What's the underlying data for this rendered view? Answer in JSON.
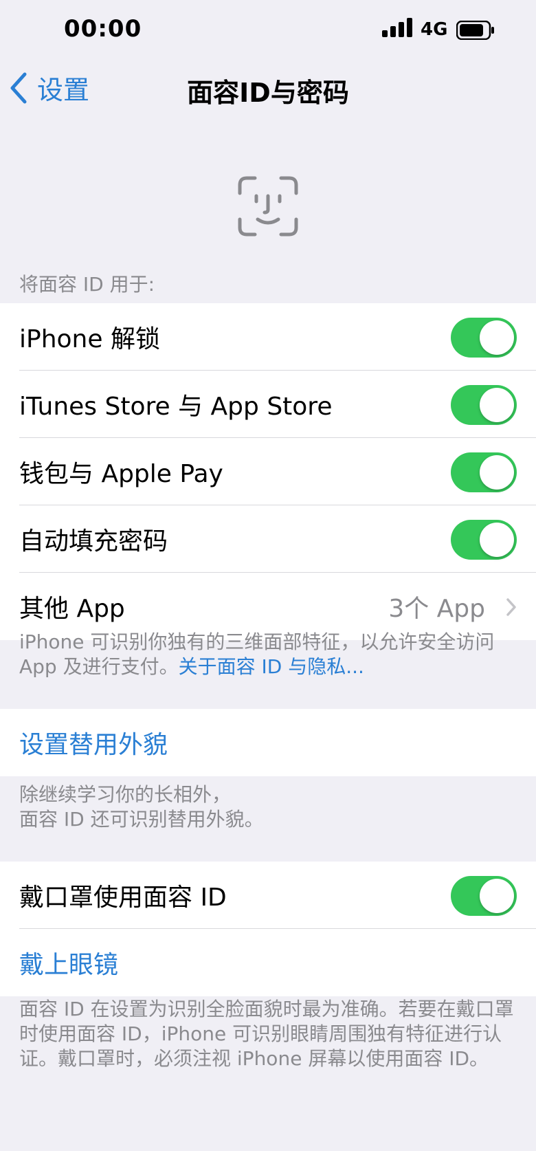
{
  "status_bar": {
    "time": "00:00",
    "network": "4G"
  },
  "nav": {
    "back_label": "设置",
    "title": "面容ID与密码"
  },
  "use_for": {
    "header": "将面容 ID 用于:",
    "items": [
      {
        "label": "iPhone 解锁",
        "on": true
      },
      {
        "label": "iTunes Store 与 App Store",
        "on": true
      },
      {
        "label": "钱包与 Apple Pay",
        "on": true
      },
      {
        "label": "自动填充密码",
        "on": true
      }
    ],
    "other_apps": {
      "label": "其他 App",
      "detail": "3个 App"
    },
    "footer_text": "iPhone 可识别你独有的三维面部特征，以允许安全访问 App 及进行支付。",
    "footer_link": "关于面容 ID 与隐私..."
  },
  "alternate": {
    "button": "设置替用外貌",
    "footer_line1": "除继续学习你的长相外，",
    "footer_line2": "面容 ID 还可识别替用外貌。"
  },
  "mask": {
    "toggle_label": "戴口罩使用面容 ID",
    "toggle_on": true,
    "glasses_button": "戴上眼镜",
    "footer_text": "面容 ID 在设置为识别全脸面貌时最为准确。若要在戴口罩时使用面容 ID，iPhone 可识别眼睛周围独有特征进行认证。戴口罩时，必须注视 iPhone 屏幕以使用面容 ID。"
  },
  "colors": {
    "accent": "#2a7fd4",
    "toggle_on": "#34c759",
    "background": "#f0eff5"
  }
}
